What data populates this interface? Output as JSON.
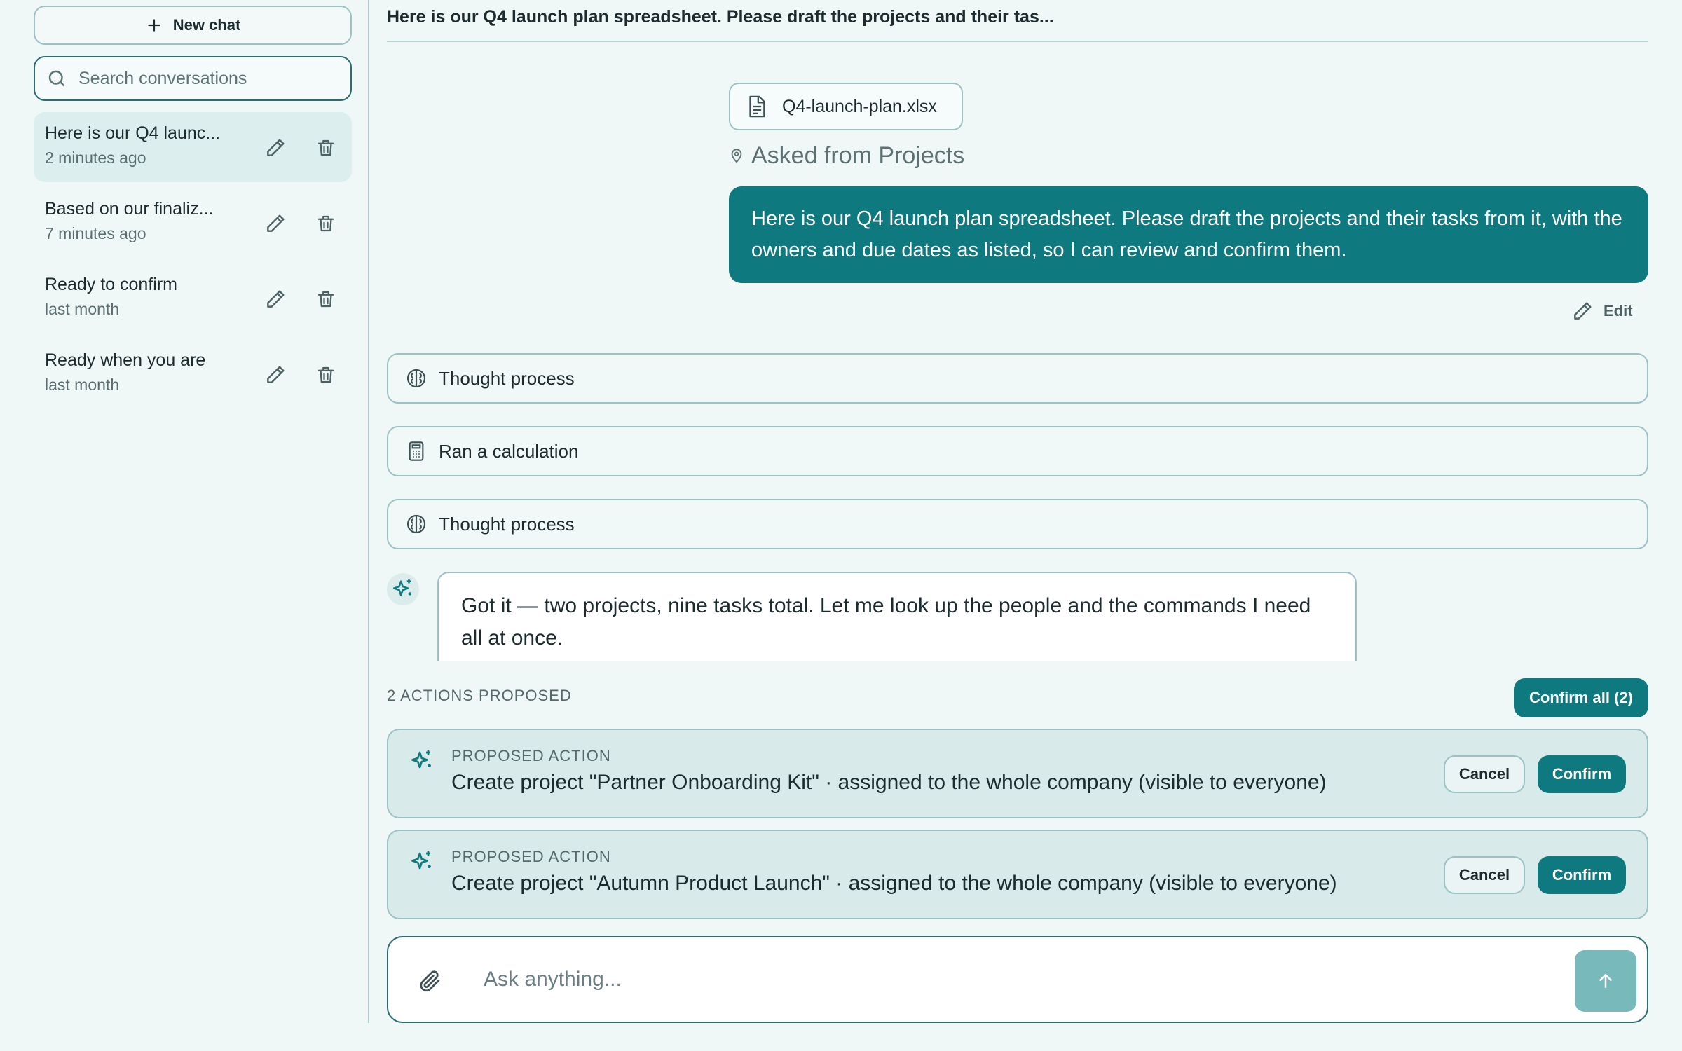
{
  "sidebar": {
    "new_chat_label": "New chat",
    "search_placeholder": "Search conversations",
    "conversations": [
      {
        "title": "Here is our Q4 launc...",
        "time": "2 minutes ago"
      },
      {
        "title": "Based on our finaliz...",
        "time": "7 minutes ago"
      },
      {
        "title": "Ready to confirm",
        "time": "last month"
      },
      {
        "title": "Ready when you are",
        "time": "last month"
      }
    ]
  },
  "main": {
    "title": "Here is our Q4 launch plan spreadsheet. Please draft the projects and their tas...",
    "attachment_name": "Q4-launch-plan.xlsx",
    "asked_from": "Asked from Projects",
    "user_message": "Here is our Q4 launch plan spreadsheet. Please draft the projects and their tasks from it, with the owners and due dates as listed, so I can review and confirm them.",
    "edit_label": "Edit",
    "steps": [
      {
        "label": "Thought process",
        "icon": "brain-icon"
      },
      {
        "label": "Ran a calculation",
        "icon": "calculator-icon"
      },
      {
        "label": "Thought process",
        "icon": "brain-icon"
      }
    ],
    "assistant_message": "Got it — two projects, nine tasks total. Let me look up the people and the commands I need all at once.",
    "actions_header": "2 ACTIONS PROPOSED",
    "confirm_all_label": "Confirm all (2)",
    "actions": [
      {
        "kicker": "PROPOSED ACTION",
        "description": "Create project \"Partner Onboarding Kit\" · assigned to the whole company (visible to everyone)",
        "cancel_label": "Cancel",
        "confirm_label": "Confirm"
      },
      {
        "kicker": "PROPOSED ACTION",
        "description": "Create project \"Autumn Product Launch\" · assigned to the whole company (visible to everyone)",
        "cancel_label": "Cancel",
        "confirm_label": "Confirm"
      }
    ],
    "composer_placeholder": "Ask anything..."
  },
  "colors": {
    "accent": "#0e7a7f",
    "background": "#eff7f7",
    "border": "#9dc2c4"
  }
}
